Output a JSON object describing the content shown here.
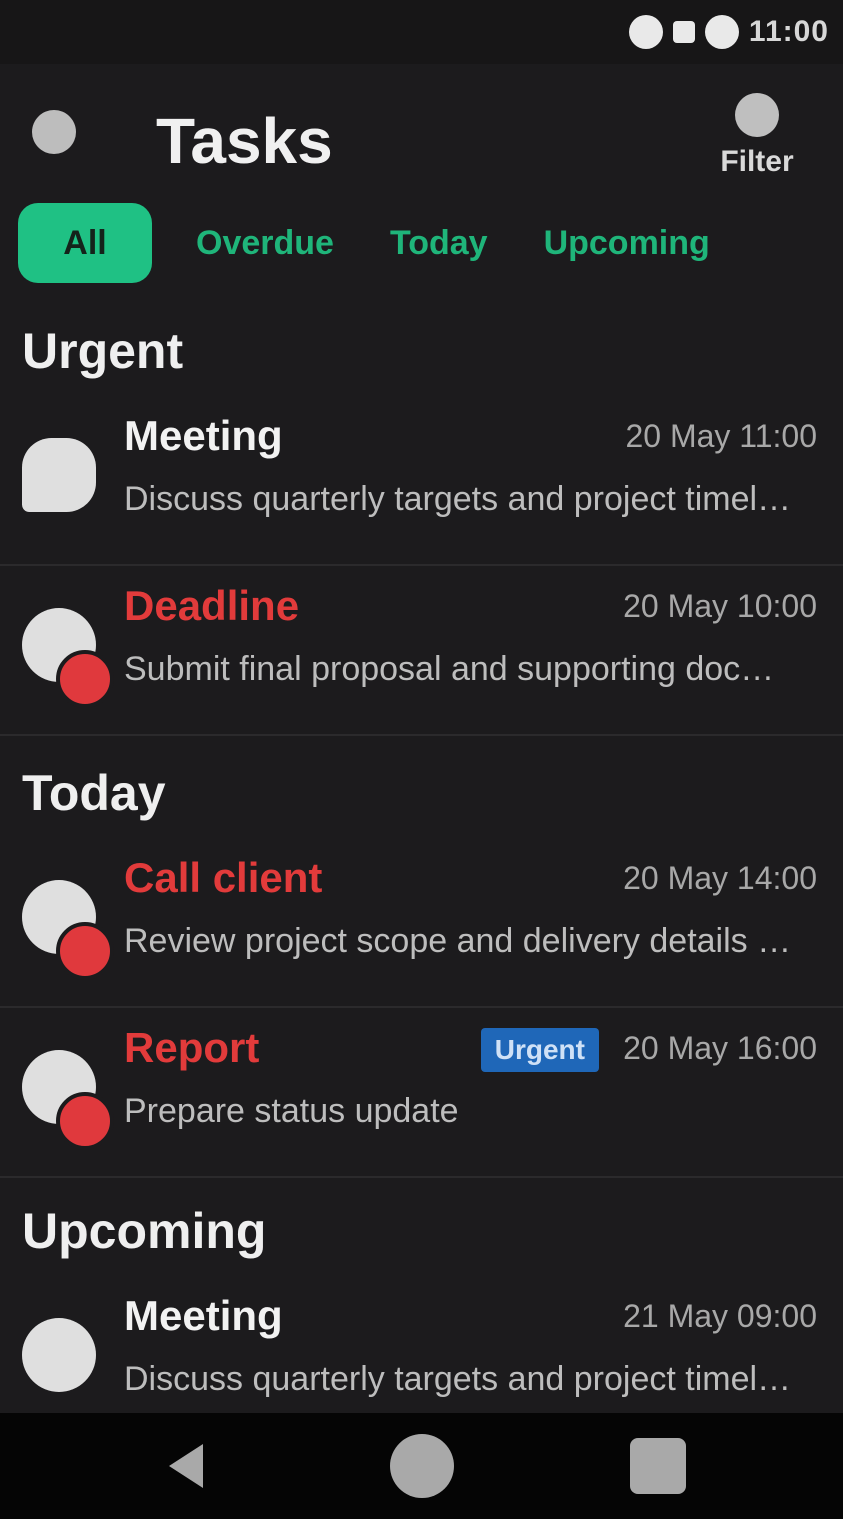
{
  "status_bar": {
    "time": "11:00"
  },
  "header": {
    "title": "Tasks",
    "filter_label": "Filter"
  },
  "tabs": [
    {
      "label": "All"
    },
    {
      "label": "Overdue"
    },
    {
      "label": "Today"
    },
    {
      "label": "Upcoming"
    }
  ],
  "sections": [
    {
      "title": "Urgent",
      "rows": [
        {
          "title": "Meeting",
          "time": "20 May 11:00",
          "subtitle": "Discuss quarterly targets and project timeline w..."
        },
        {
          "title": "Deadline",
          "time": "20 May 10:00",
          "subtitle": "Submit final proposal and supporting documen..."
        }
      ]
    },
    {
      "title": "Today",
      "rows": [
        {
          "title": "Call client",
          "time": "20 May 14:00",
          "subtitle": "Review project scope and delivery details with..."
        },
        {
          "title": "Report",
          "time": "20 May 16:00",
          "subtitle": "Prepare status update",
          "tag": "Urgent"
        }
      ]
    },
    {
      "title": "Upcoming",
      "rows": [
        {
          "title": "Meeting",
          "time": "21 May 09:00",
          "subtitle": "Discuss quarterly targets and project timeline w..."
        }
      ]
    }
  ],
  "colors": {
    "accent": "#1fc184",
    "alert": "#e23b3b",
    "tag": "#1f67b8",
    "background": "#1c1b1d"
  },
  "icons": [
    "menu-icon",
    "filter-icon",
    "chat-icon",
    "alert-badge-icon",
    "back-icon",
    "home-icon",
    "recents-icon"
  ]
}
